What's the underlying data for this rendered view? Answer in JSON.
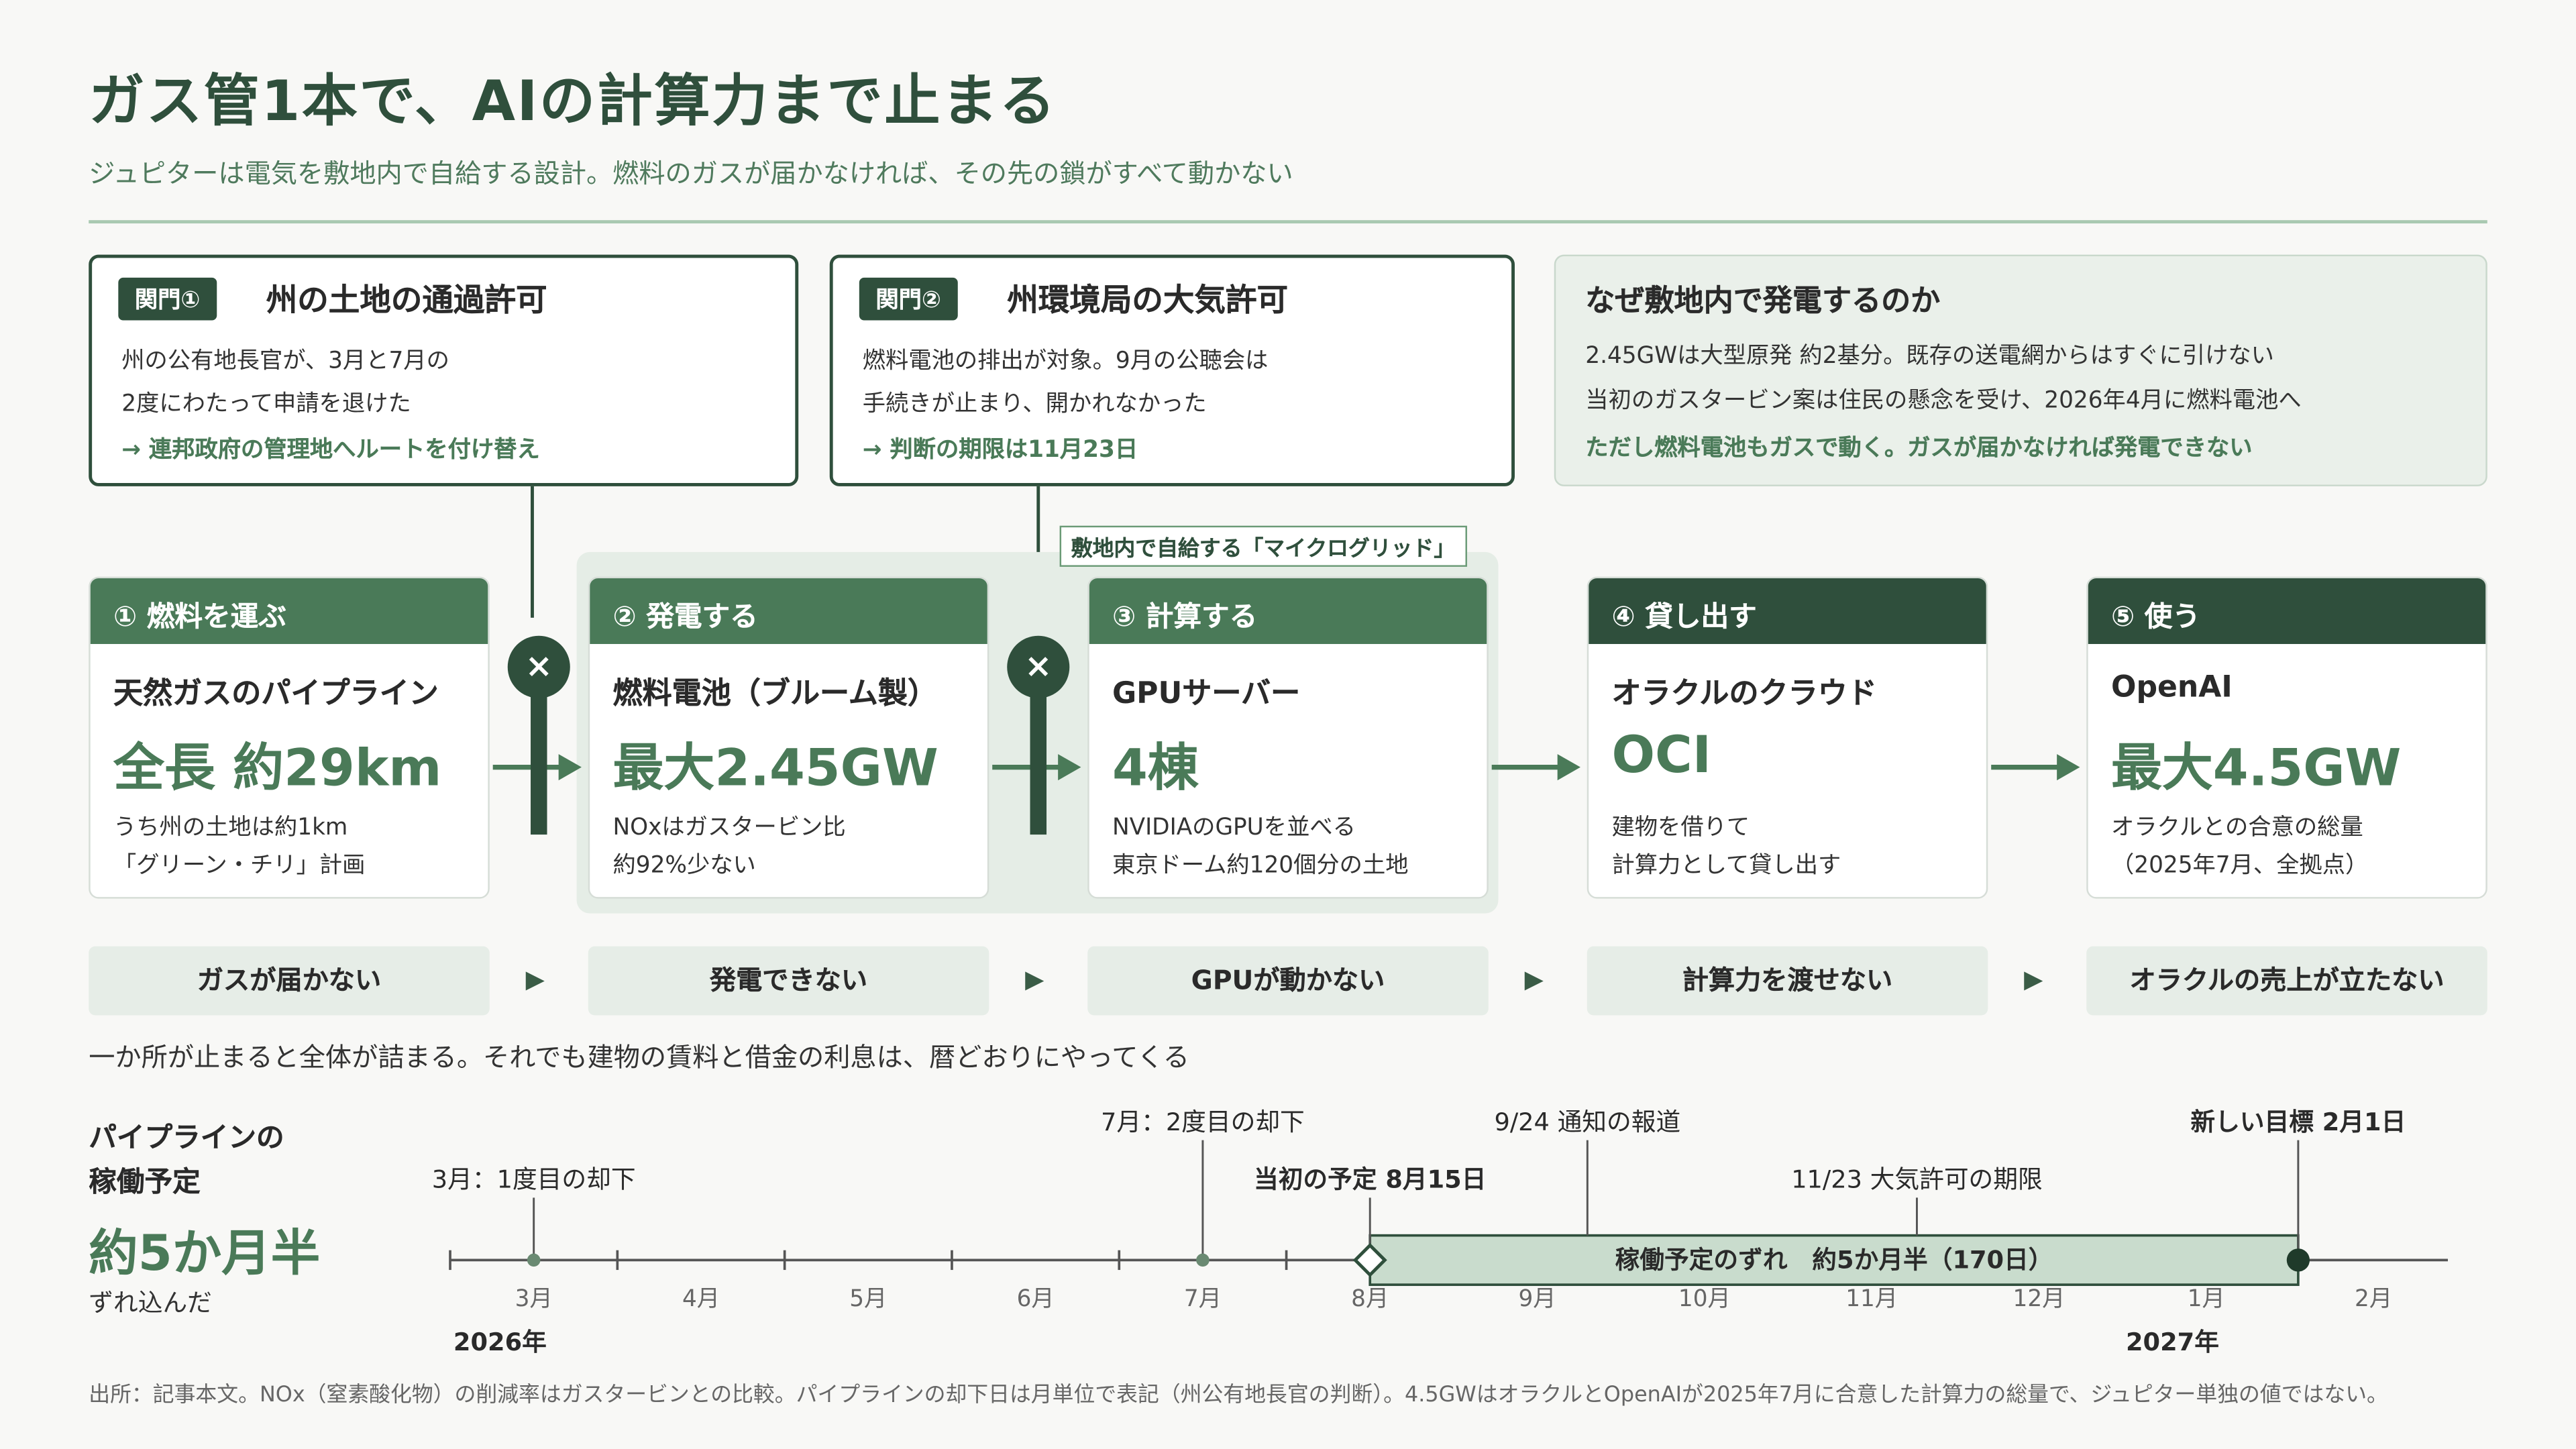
{
  "title": "ガス管1本で、AIの計算力まで止まる",
  "subtitle": "ジュピターは電気を敷地内で自給する設計。燃料のガスが届かなければ、その先の鎖がすべて動かない",
  "gates": [
    {
      "tag": "関門①",
      "title": "州の土地の通過許可",
      "lines": [
        "州の公有地長官が、3月と7月の",
        "2度にわたって申請を退けた"
      ],
      "note": "→ 連邦政府の管理地へルートを付け替え"
    },
    {
      "tag": "関門②",
      "title": "州環境局の大気許可",
      "lines": [
        "燃料電池の排出が対象。9月の公聴会は",
        "手続きが止まり、開かれなかった"
      ],
      "note": "→ 判断の期限は11月23日"
    }
  ],
  "why": {
    "title": "なぜ敷地内で発電するのか",
    "lines": [
      "2.45GWは大型原発 約2基分。既存の送電網からはすぐに引けない",
      "当初のガスタービン案は住民の懸念を受け、2026年4月に燃料電池へ"
    ],
    "note": "ただし燃料電池もガスで動く。ガスが届かなければ発電できない"
  },
  "microgrid_label": "敷地内で自給する「マイクログリッド」",
  "block_mark": "×",
  "steps": [
    {
      "head": "① 燃料を運ぶ",
      "name": "天然ガスのパイプライン",
      "big": "全長 約29km",
      "desc": [
        "うち州の土地は約1km",
        "「グリーン・チリ」計画"
      ]
    },
    {
      "head": "② 発電する",
      "name": "燃料電池（ブルーム製）",
      "big": "最大2.45GW",
      "desc": [
        "NOxはガスタービン比",
        "約92%少ない"
      ]
    },
    {
      "head": "③ 計算する",
      "name": "GPUサーバー",
      "big": "4棟",
      "desc": [
        "NVIDIAのGPUを並べる",
        "東京ドーム約120個分の土地"
      ]
    },
    {
      "head": "④ 貸し出す",
      "name": "オラクルのクラウド",
      "big": "OCI",
      "desc": [
        "建物を借りて",
        "計算力として貸し出す"
      ]
    },
    {
      "head": "⑤ 使う",
      "name": "OpenAI",
      "big": "最大4.5GW",
      "desc": [
        "オラクルとの合意の総量",
        "（2025年7月、全拠点）"
      ]
    }
  ],
  "consequences": [
    "ガスが届かない",
    "発電できない",
    "GPUが動かない",
    "計算力を渡せない",
    "オラクルの売上が立たない"
  ],
  "arrow_glyph": "▶",
  "summary": "一か所が止まると全体が詰まる。それでも建物の賃料と借金の利息は、暦どおりにやってくる",
  "timeline": {
    "heading": [
      "パイプラインの",
      "稼働予定"
    ],
    "big": "約5か月半",
    "sub": "ずれ込んだ",
    "months": [
      "3月",
      "4月",
      "5月",
      "6月",
      "7月",
      "8月",
      "9月",
      "10月",
      "11月",
      "12月",
      "1月",
      "2月"
    ],
    "years": [
      {
        "label": "2026年",
        "month_index": 0
      },
      {
        "label": "2027年",
        "month_index": 10
      }
    ],
    "events": [
      {
        "label": "3月：1度目の却下",
        "month": 3.5,
        "row": 2,
        "bold": false,
        "marker": "dot"
      },
      {
        "label": "7月：2度目の却下",
        "month": 7.5,
        "row": 1,
        "bold": false,
        "marker": "dot"
      },
      {
        "label": "当初の予定 8月15日",
        "month": 8.5,
        "row": 2,
        "bold": true,
        "marker": "diamond"
      },
      {
        "label": "9/24 通知の報道",
        "month": 9.8,
        "row": 1,
        "bold": false,
        "marker": "tick"
      },
      {
        "label": "11/23 大気許可の期限",
        "month": 11.77,
        "row": 2,
        "bold": false,
        "marker": "tick"
      },
      {
        "label": "新しい目標 2月1日",
        "month": 14.05,
        "row": 1,
        "bold": true,
        "marker": "circle"
      }
    ],
    "delay_bar": {
      "label": "稼働予定のずれ　約5か月半（170日）",
      "start_month": 8.5,
      "end_month": 14.05
    }
  },
  "footnote": "出所：記事本文。NOx（窒素酸化物）の削減率はガスタービンとの比較。パイプラインの却下日は月単位で表記（州公有地長官の判断）。4.5GWはオラクルとOpenAIが2025年7月に合意した計算力の総量で、ジュピター単独の値ではない。",
  "colors": {
    "dark": "#2f4f3c",
    "mid": "#4a7a58",
    "light": "#e6ede7",
    "bar": "#c9dccd"
  }
}
